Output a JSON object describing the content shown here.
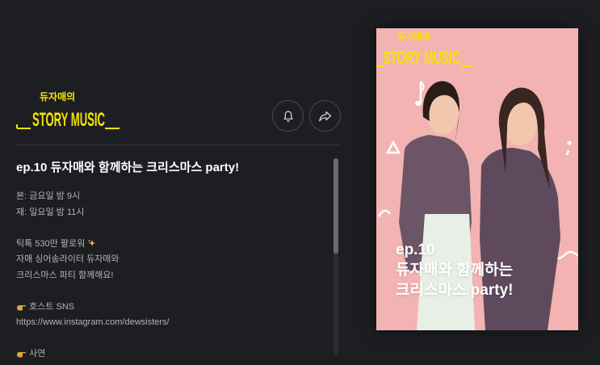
{
  "show": {
    "logo_small": "듀자매의",
    "logo_big": "STORY MUSIC",
    "logo_color": "#f5e400"
  },
  "actions": {
    "bell": "bell-icon",
    "share": "share-icon"
  },
  "episode": {
    "title": "ep.10 듀자매와 함께하는 크리스마스 party!",
    "schedule_main": "본: 금요일 밤 9시",
    "schedule_re": "재: 일요일 밤 11시",
    "desc_line1": "틱톡 530만 팔로워",
    "desc_line2": "자매 싱어송라이터 듀자매와",
    "desc_line3": "크리스마스 파티 함께해요!",
    "host_label": "호스트 SNS",
    "host_url": "https://www.instagram.com/dewsisters/",
    "story_label": "사연"
  },
  "cover": {
    "logo_small": "듀자매의",
    "logo_big": "STORY MUSIC",
    "ep": "ep.10",
    "line1": "듀자매와 함께하는",
    "line2": "크리스마스 party!",
    "bg_color": "#f2b3b2"
  }
}
